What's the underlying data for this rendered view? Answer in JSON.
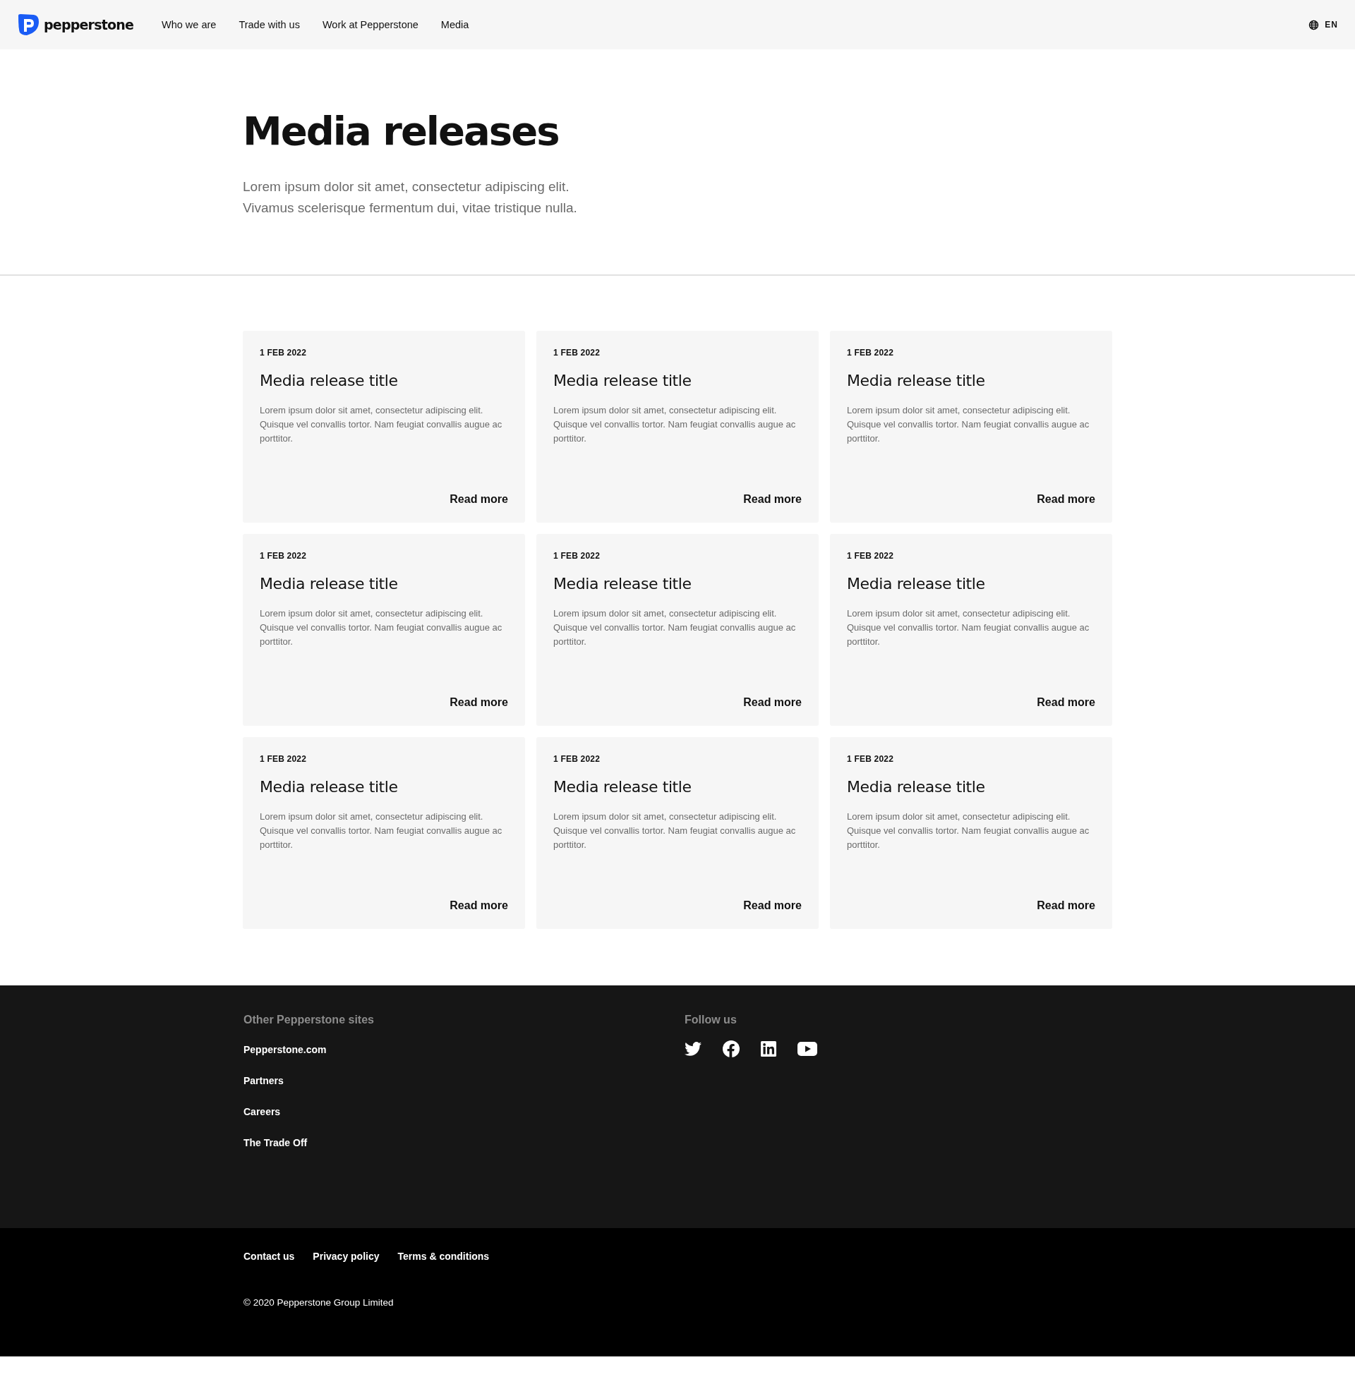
{
  "header": {
    "logo": "pepperstone",
    "nav": [
      "Who we are",
      "Trade with us",
      "Work at Pepperstone",
      "Media"
    ],
    "language": "EN"
  },
  "hero": {
    "title": "Media releases",
    "lead": "Lorem ipsum dolor sit amet, consectetur adipiscing elit. Vivamus scelerisque fermentum dui, vitae tristique nulla."
  },
  "releases": [
    {
      "date": "1 FEB 2022",
      "title": "Media release title",
      "summary": "Lorem ipsum dolor sit amet, consectetur adipiscing elit. Quisque vel convallis tortor. Nam feugiat convallis augue ac porttitor.",
      "link": "Read more"
    },
    {
      "date": "1 FEB 2022",
      "title": "Media release title",
      "summary": "Lorem ipsum dolor sit amet, consectetur adipiscing elit. Quisque vel convallis tortor. Nam feugiat convallis augue ac porttitor.",
      "link": "Read more"
    },
    {
      "date": "1 FEB 2022",
      "title": "Media release title",
      "summary": "Lorem ipsum dolor sit amet, consectetur adipiscing elit. Quisque vel convallis tortor. Nam feugiat convallis augue ac porttitor.",
      "link": "Read more"
    },
    {
      "date": "1 FEB 2022",
      "title": "Media release title",
      "summary": "Lorem ipsum dolor sit amet, consectetur adipiscing elit. Quisque vel convallis tortor. Nam feugiat convallis augue ac porttitor.",
      "link": "Read more"
    },
    {
      "date": "1 FEB 2022",
      "title": "Media release title",
      "summary": "Lorem ipsum dolor sit amet, consectetur adipiscing elit. Quisque vel convallis tortor. Nam feugiat convallis augue ac porttitor.",
      "link": "Read more"
    },
    {
      "date": "1 FEB 2022",
      "title": "Media release title",
      "summary": "Lorem ipsum dolor sit amet, consectetur adipiscing elit. Quisque vel convallis tortor. Nam feugiat convallis augue ac porttitor.",
      "link": "Read more"
    },
    {
      "date": "1 FEB 2022",
      "title": "Media release title",
      "summary": "Lorem ipsum dolor sit amet, consectetur adipiscing elit. Quisque vel convallis tortor. Nam feugiat convallis augue ac porttitor.",
      "link": "Read more"
    },
    {
      "date": "1 FEB 2022",
      "title": "Media release title",
      "summary": "Lorem ipsum dolor sit amet, consectetur adipiscing elit. Quisque vel convallis tortor. Nam feugiat convallis augue ac porttitor.",
      "link": "Read more"
    },
    {
      "date": "1 FEB 2022",
      "title": "Media release title",
      "summary": "Lorem ipsum dolor sit amet, consectetur adipiscing elit. Quisque vel convallis tortor. Nam feugiat convallis augue ac porttitor.",
      "link": "Read more"
    }
  ],
  "footer": {
    "sites_heading": "Other Pepperstone sites",
    "sites": [
      "Pepperstone.com",
      "Partners",
      "Careers",
      "The Trade Off"
    ],
    "follow_heading": "Follow us",
    "social": [
      {
        "kind": "twitter"
      },
      {
        "kind": "facebook"
      },
      {
        "kind": "linkedin"
      },
      {
        "kind": "youtube"
      }
    ],
    "legal_links": [
      "Contact us",
      "Privacy policy",
      "Terms & conditions"
    ],
    "copyright": "© 2020 Pepperstone Group Limited"
  }
}
